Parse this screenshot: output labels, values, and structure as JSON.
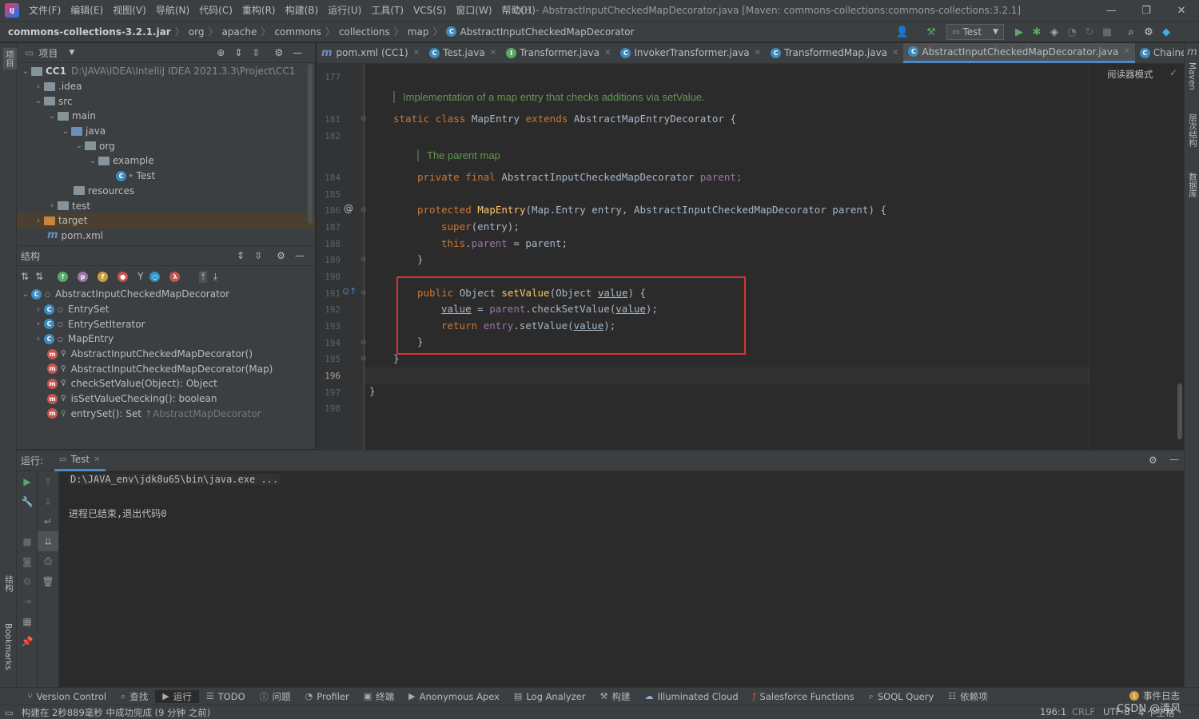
{
  "app": {
    "logo": "IJ",
    "menu": [
      "文件(F)",
      "编辑(E)",
      "视图(V)",
      "导航(N)",
      "代码(C)",
      "重构(R)",
      "构建(B)",
      "运行(U)",
      "工具(T)",
      "VCS(S)",
      "窗口(W)",
      "帮助(H)"
    ],
    "title": "CC1 - AbstractInputCheckedMapDecorator.java [Maven: commons-collections:commons-collections:3.2.1]"
  },
  "nav": {
    "breadcrumbs": [
      "commons-collections-3.2.1.jar",
      "org",
      "apache",
      "commons",
      "collections",
      "map",
      "AbstractInputCheckedMapDecorator"
    ],
    "run_config": "Test"
  },
  "left_strip": {
    "top": "项目",
    "mid": "结构",
    "bottom": "Bookmarks"
  },
  "right_strip": {
    "maven": "Maven",
    "hier": "层次结构",
    "db": "数据库"
  },
  "project": {
    "header": "项目",
    "items": [
      {
        "label": "CC1",
        "extra": "D:\\JAVA\\IDEA\\IntelliJ IDEA 2021.3.3\\Project\\CC1"
      },
      {
        "label": ".idea"
      },
      {
        "label": "src"
      },
      {
        "label": "main"
      },
      {
        "label": "java"
      },
      {
        "label": "org"
      },
      {
        "label": "example"
      },
      {
        "label": "Test"
      },
      {
        "label": "resources"
      },
      {
        "label": "test"
      },
      {
        "label": "target"
      },
      {
        "label": "pom.xml"
      }
    ]
  },
  "structure": {
    "header": "结构",
    "items": [
      {
        "label": "AbstractInputCheckedMapDecorator"
      },
      {
        "label": "EntrySet"
      },
      {
        "label": "EntrySetIterator"
      },
      {
        "label": "MapEntry"
      },
      {
        "label": "AbstractInputCheckedMapDecorator()"
      },
      {
        "label": "AbstractInputCheckedMapDecorator(Map)"
      },
      {
        "label": "checkSetValue(Object): Object"
      },
      {
        "label": "isSetValueChecking(): boolean"
      },
      {
        "label": "entrySet(): Set",
        "extra": "↑AbstractMapDecorator"
      }
    ]
  },
  "editor": {
    "tabs": [
      "pom.xml (CC1)",
      "Test.java",
      "Transformer.java",
      "InvokerTransformer.java",
      "TransformedMap.java",
      "AbstractInputCheckedMapDecorator.java",
      "Chained"
    ],
    "reader_mode": "阅读器模式",
    "line_numbers": [
      "177",
      "181",
      "182",
      "184",
      "185",
      "186",
      "187",
      "188",
      "189",
      "190",
      "191",
      "192",
      "193",
      "194",
      "195",
      "196",
      "197",
      "198"
    ],
    "doc1": "Implementation of a map entry that checks additions via setValue.",
    "doc2": "The parent map",
    "code": {
      "l181a": "static class ",
      "l181b": "MapEntry ",
      "l181c": "extends ",
      "l181d": "AbstractMapEntryDecorator {",
      "l184a": "private final ",
      "l184b": "AbstractInputCheckedMapDecorator ",
      "l184c": "parent",
      ";": ";",
      "l186a": "protected ",
      "l186b": "MapEntry",
      "l186c": "(Map.Entry entry, AbstractInputCheckedMapDecorator parent) {",
      "l187a": "super",
      "l187b": "(entry);",
      "l188a": "this",
      ".": ".",
      "l188b": "parent",
      " = ": " = ",
      "l188c": "parent;",
      "close": "}",
      "l191a": "public ",
      "l191b": "Object ",
      "l191c": "setValue",
      "l191d": "(Object ",
      "l191e": "value",
      ")": ") {",
      "l192a": "value",
      "l192b": " = ",
      "l192c": "parent",
      ".checkSetValue(": ".checkSetValue(",
      "l192d": "value",
      "l192e": ");",
      "l193a": "return ",
      "l193b": "entry",
      ".setValue(": ".setValue(",
      "l193c": "value",
      "l193d": ");"
    }
  },
  "run": {
    "label": "运行:",
    "tab": "Test",
    "line1": "D:\\JAVA_env\\jdk8u65\\bin\\java.exe ...",
    "line2": "进程已结束,退出代码0"
  },
  "bottom_tools": [
    "Version Control",
    "查找",
    "运行",
    "TODO",
    "问题",
    "Profiler",
    "终端",
    "Anonymous Apex",
    "Log Analyzer",
    "构建",
    "Illuminated Cloud",
    "Salesforce Functions",
    "SOQL Query",
    "依赖项"
  ],
  "event_log": "事件日志",
  "status": {
    "message": "构建在 2秒889毫秒 中成功完成 (9 分钟 之前)",
    "position": "196:1",
    "eol": "CRLF",
    "encoding": "UTF-8",
    "indent": "4 个空格",
    "watermark": "CSDN @清风"
  },
  "colors": {
    "accent": "#4a88c7",
    "highlight": "#e03030",
    "keyword": "#cc7832",
    "doc": "#629755"
  }
}
